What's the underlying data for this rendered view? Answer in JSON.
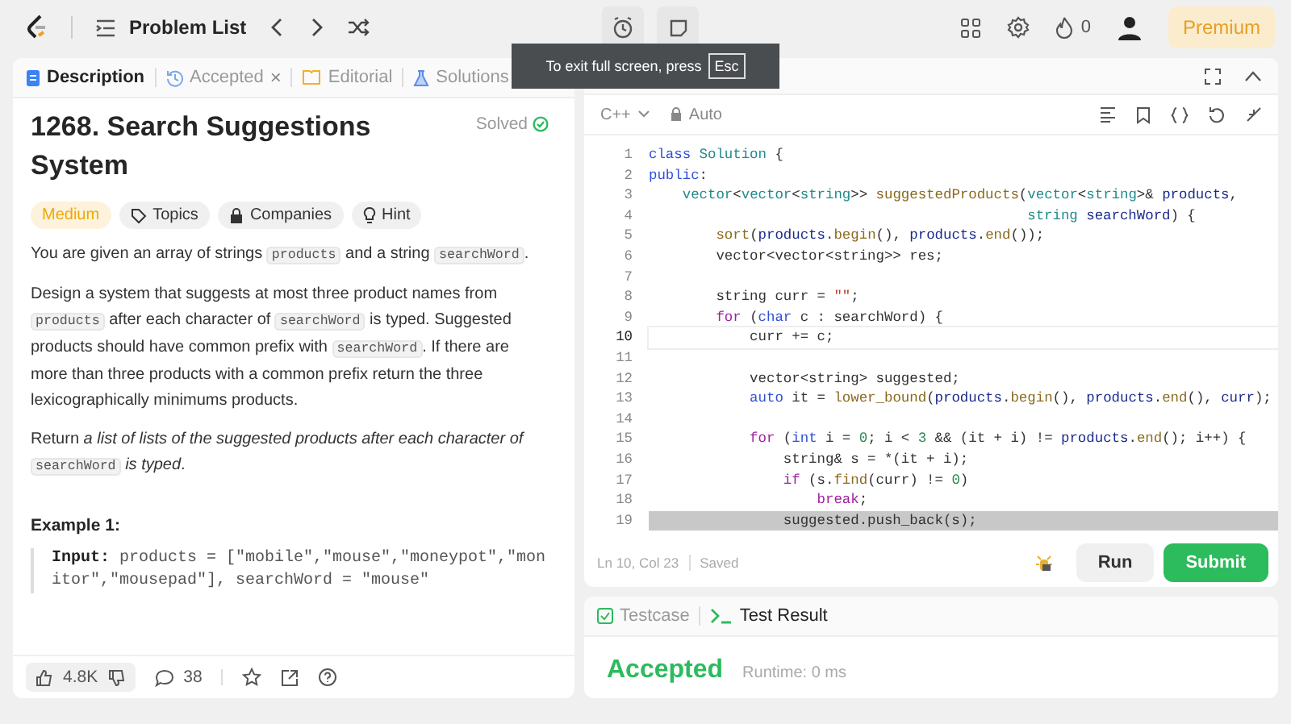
{
  "top_bar": {
    "problem_list": "Problem List",
    "streak": "0",
    "premium": "Premium"
  },
  "fullscreen_toast": {
    "text": "To exit full screen, press",
    "key": "Esc"
  },
  "left_tabs": [
    {
      "label": "Description",
      "kind": "description",
      "selected": true
    },
    {
      "label": "Accepted",
      "kind": "accepted",
      "selected": false,
      "close": "×"
    },
    {
      "label": "Editorial",
      "kind": "editorial",
      "selected": false
    },
    {
      "label": "Solutions",
      "kind": "solutions",
      "selected": false
    }
  ],
  "problem": {
    "title": "1268. Search Suggestions System",
    "status": "Solved",
    "tags": [
      {
        "label": "Medium",
        "kind": "difficulty"
      },
      {
        "label": "Topics",
        "kind": "topics"
      },
      {
        "label": "Companies",
        "kind": "companies"
      },
      {
        "label": "Hint",
        "kind": "hint"
      }
    ],
    "paragraphs": [
      [
        {
          "kind": "text",
          "text": "You are given an array of strings "
        },
        {
          "kind": "code",
          "text": "products"
        },
        {
          "kind": "text",
          "text": " and a string "
        },
        {
          "kind": "code",
          "text": "searchWord"
        },
        {
          "kind": "text",
          "text": "."
        }
      ],
      [
        {
          "kind": "text",
          "text": "Design a system that suggests at most three product names from "
        },
        {
          "kind": "code",
          "text": "products"
        },
        {
          "kind": "text",
          "text": " after each character of "
        },
        {
          "kind": "code",
          "text": "searchWord"
        },
        {
          "kind": "text",
          "text": " is typed. Suggested products should have common prefix with "
        },
        {
          "kind": "code",
          "text": "searchWord"
        },
        {
          "kind": "text",
          "text": ". If there are more than three products with a common prefix return the three lexicographically minimums products."
        }
      ],
      [
        {
          "kind": "text",
          "text": "Return "
        },
        {
          "kind": "italic",
          "text": "a list of lists of the suggested products after each character of "
        },
        {
          "kind": "code",
          "text": "searchWord"
        },
        {
          "kind": "italic",
          "text": " is typed"
        },
        {
          "kind": "text",
          "text": "."
        }
      ]
    ],
    "example_title": "Example 1:",
    "example_label": "Input:",
    "example_input": "products = [\"mobile\",\"mouse\",\"moneypot\",\"monitor\",\"mousepad\"], searchWord = \"mouse\"",
    "likes": "4.8K",
    "comments": "38"
  },
  "editor": {
    "language": "C++",
    "mode": "Auto",
    "status": "Ln 10, Col 23",
    "saved": "Saved",
    "lines": [
      {
        "number": "1",
        "current": false,
        "highlighted": false,
        "tokens": [
          {
            "kind": "keyword",
            "text": "class "
          },
          {
            "kind": "type",
            "text": "Solution"
          },
          {
            "kind": "plain",
            "text": " {"
          }
        ]
      },
      {
        "number": "2",
        "current": false,
        "highlighted": false,
        "tokens": [
          {
            "kind": "keyword",
            "text": "public"
          },
          {
            "kind": "plain",
            "text": ":"
          }
        ]
      },
      {
        "number": "3",
        "current": false,
        "highlighted": false,
        "tokens": [
          {
            "kind": "type",
            "text": "    vector"
          },
          {
            "kind": "plain",
            "text": "<"
          },
          {
            "kind": "type",
            "text": "vector"
          },
          {
            "kind": "plain",
            "text": "<"
          },
          {
            "kind": "type",
            "text": "string"
          },
          {
            "kind": "plain",
            "text": ">> "
          },
          {
            "kind": "function",
            "text": "suggestedProducts"
          },
          {
            "kind": "plain",
            "text": "("
          },
          {
            "kind": "type",
            "text": "vector"
          },
          {
            "kind": "plain",
            "text": "<"
          },
          {
            "kind": "type",
            "text": "string"
          },
          {
            "kind": "plain",
            "text": ">& "
          },
          {
            "kind": "variable",
            "text": "products"
          },
          {
            "kind": "plain",
            "text": ","
          }
        ]
      },
      {
        "number": "4",
        "current": false,
        "highlighted": false,
        "tokens": [
          {
            "kind": "type",
            "text": "                                             string "
          },
          {
            "kind": "variable",
            "text": "searchWord"
          },
          {
            "kind": "plain",
            "text": ") {"
          }
        ]
      },
      {
        "number": "5",
        "current": false,
        "highlighted": false,
        "tokens": [
          {
            "kind": "function",
            "text": "        sort"
          },
          {
            "kind": "plain",
            "text": "("
          },
          {
            "kind": "variable",
            "text": "products"
          },
          {
            "kind": "plain",
            "text": "."
          },
          {
            "kind": "function",
            "text": "begin"
          },
          {
            "kind": "plain",
            "text": "(), "
          },
          {
            "kind": "variable",
            "text": "products"
          },
          {
            "kind": "plain",
            "text": "."
          },
          {
            "kind": "function",
            "text": "end"
          },
          {
            "kind": "plain",
            "text": "());"
          }
        ]
      },
      {
        "number": "6",
        "current": false,
        "highlighted": false,
        "tokens": [
          {
            "kind": "plain",
            "text": "        vector<vector<string>> res;"
          }
        ]
      },
      {
        "number": "7",
        "current": false,
        "highlighted": false
      },
      {
        "number": "8",
        "current": false,
        "highlighted": false,
        "tokens": [
          {
            "kind": "plain",
            "text": "        string curr = "
          },
          {
            "kind": "string",
            "text": "\"\""
          },
          {
            "kind": "plain",
            "text": ";"
          }
        ]
      },
      {
        "number": "9",
        "current": false,
        "highlighted": false,
        "tokens": [
          {
            "kind": "control",
            "text": "        for"
          },
          {
            "kind": "plain",
            "text": " ("
          },
          {
            "kind": "keyword",
            "text": "char"
          },
          {
            "kind": "plain",
            "text": " c : searchWord) {"
          }
        ]
      },
      {
        "number": "10",
        "current": true,
        "highlighted": false,
        "tokens": [
          {
            "kind": "plain",
            "text": "            curr += c;"
          }
        ]
      },
      {
        "number": "11",
        "current": false,
        "highlighted": false
      },
      {
        "number": "12",
        "current": false,
        "highlighted": false,
        "tokens": [
          {
            "kind": "plain",
            "text": "            vector<string> suggested;"
          }
        ]
      },
      {
        "number": "13",
        "current": false,
        "highlighted": false,
        "tokens": [
          {
            "kind": "keyword",
            "text": "            auto"
          },
          {
            "kind": "plain",
            "text": " it = "
          },
          {
            "kind": "function",
            "text": "lower_bound"
          },
          {
            "kind": "plain",
            "text": "("
          },
          {
            "kind": "variable",
            "text": "products"
          },
          {
            "kind": "plain",
            "text": "."
          },
          {
            "kind": "function",
            "text": "begin"
          },
          {
            "kind": "plain",
            "text": "(), "
          },
          {
            "kind": "variable",
            "text": "products"
          },
          {
            "kind": "plain",
            "text": "."
          },
          {
            "kind": "function",
            "text": "end"
          },
          {
            "kind": "plain",
            "text": "(), "
          },
          {
            "kind": "variable",
            "text": "curr"
          },
          {
            "kind": "plain",
            "text": ");"
          }
        ]
      },
      {
        "number": "14",
        "current": false,
        "highlighted": false
      },
      {
        "number": "15",
        "current": false,
        "highlighted": false,
        "tokens": [
          {
            "kind": "control",
            "text": "            for"
          },
          {
            "kind": "plain",
            "text": " ("
          },
          {
            "kind": "keyword",
            "text": "int"
          },
          {
            "kind": "plain",
            "text": " i = "
          },
          {
            "kind": "number",
            "text": "0"
          },
          {
            "kind": "plain",
            "text": "; i < "
          },
          {
            "kind": "number",
            "text": "3"
          },
          {
            "kind": "plain",
            "text": " && (it + i) != "
          },
          {
            "kind": "variable",
            "text": "products"
          },
          {
            "kind": "plain",
            "text": "."
          },
          {
            "kind": "function",
            "text": "end"
          },
          {
            "kind": "plain",
            "text": "(); i++) {"
          }
        ]
      },
      {
        "number": "16",
        "current": false,
        "highlighted": false,
        "tokens": [
          {
            "kind": "plain",
            "text": "                string& s = *(it + i);"
          }
        ]
      },
      {
        "number": "17",
        "current": false,
        "highlighted": false,
        "tokens": [
          {
            "kind": "control",
            "text": "                if"
          },
          {
            "kind": "plain",
            "text": " (s."
          },
          {
            "kind": "function",
            "text": "find"
          },
          {
            "kind": "plain",
            "text": "(curr) != "
          },
          {
            "kind": "number",
            "text": "0"
          },
          {
            "kind": "plain",
            "text": ")"
          }
        ]
      },
      {
        "number": "18",
        "current": false,
        "highlighted": false,
        "tokens": [
          {
            "kind": "control",
            "text": "                    break"
          },
          {
            "kind": "plain",
            "text": ";"
          }
        ]
      },
      {
        "number": "19",
        "current": false,
        "highlighted": true,
        "tokens": [
          {
            "kind": "plain",
            "text": "                suggested.push_back(s);"
          }
        ]
      }
    ],
    "run": "Run",
    "submit": "Submit"
  },
  "result_tabs": [
    {
      "label": "Testcase",
      "kind": "testcase",
      "selected": false
    },
    {
      "label": "Test Result",
      "kind": "result",
      "selected": true
    }
  ],
  "result": {
    "verdict": "Accepted",
    "runtime": "Runtime: 0 ms"
  }
}
